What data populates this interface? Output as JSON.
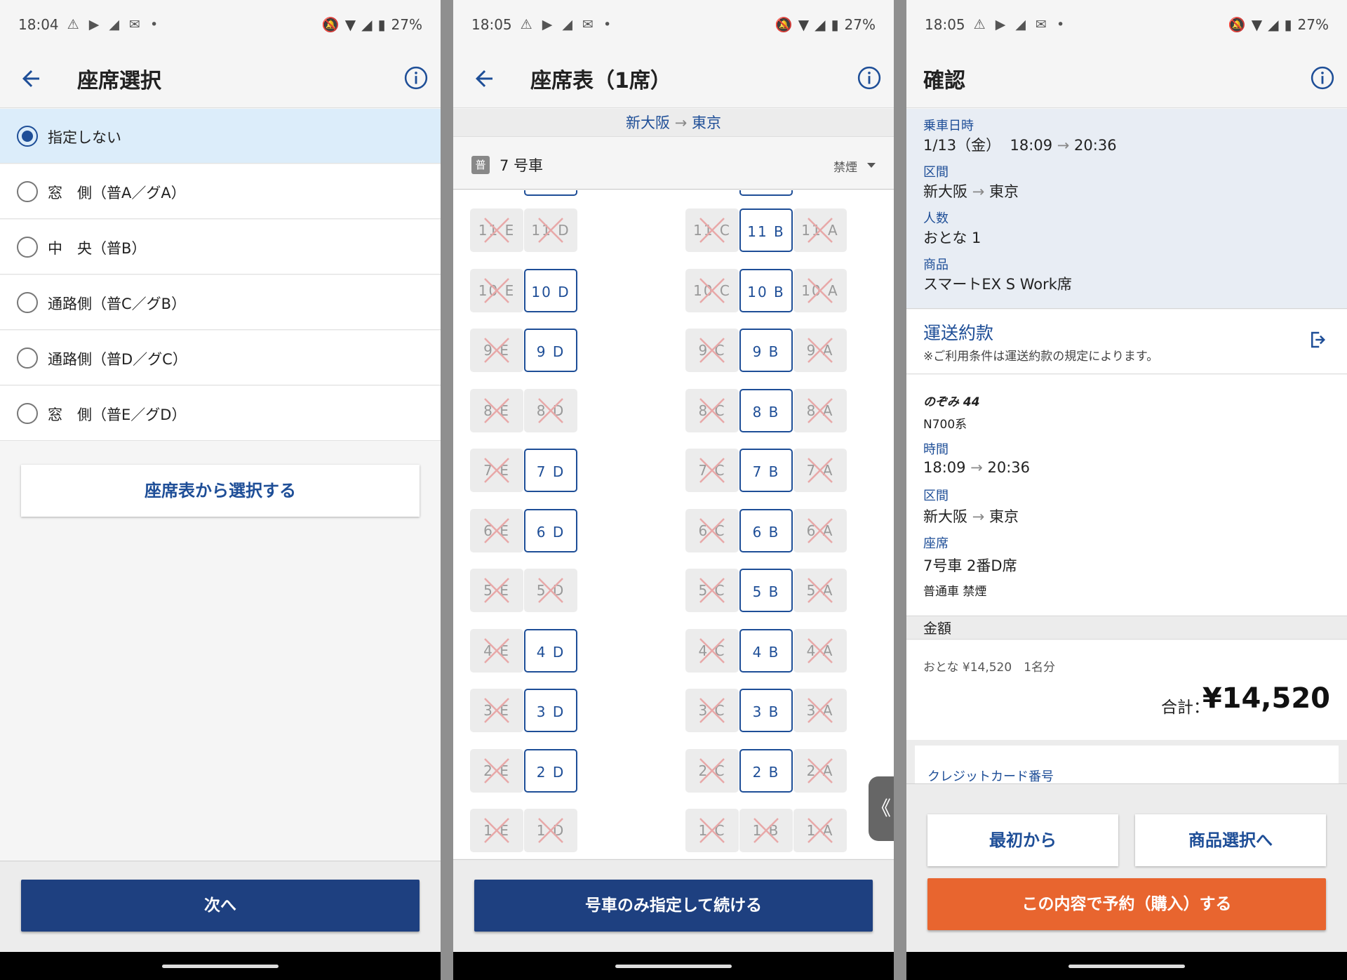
{
  "colors": {
    "brand": "#1e4080",
    "link": "#1e4e97",
    "accent": "#e8652f"
  },
  "s1": {
    "status": {
      "time": "18:04",
      "battery": "27%"
    },
    "title": "座席選択",
    "options": [
      "指定しない",
      "窓　側（普A／グA）",
      "中　央（普B）",
      "通路側（普C／グB）",
      "通路側（普D／グC）",
      "窓　側（普E／グD）"
    ],
    "selected_index": 0,
    "map_button": "座席表から選択する",
    "next_button": "次へ"
  },
  "s2": {
    "status": {
      "time": "18:05",
      "battery": "27%"
    },
    "title": "座席表（1席）",
    "route_from": "新大阪",
    "route_to": "東京",
    "car_badge": "普",
    "car_label": "7 号車",
    "smoking": "禁煙",
    "rows": [
      {
        "row": "11",
        "E": "taken",
        "D": "taken",
        "C": "taken",
        "B": "avail",
        "A": "taken"
      },
      {
        "row": "10",
        "E": "taken",
        "D": "avail",
        "C": "taken",
        "B": "avail",
        "A": "taken"
      },
      {
        "row": "9",
        "E": "taken",
        "D": "avail",
        "C": "taken",
        "B": "avail",
        "A": "taken"
      },
      {
        "row": "8",
        "E": "taken",
        "D": "taken",
        "C": "taken",
        "B": "avail",
        "A": "taken"
      },
      {
        "row": "7",
        "E": "taken",
        "D": "avail",
        "C": "taken",
        "B": "avail",
        "A": "taken"
      },
      {
        "row": "6",
        "E": "taken",
        "D": "avail",
        "C": "taken",
        "B": "avail",
        "A": "taken"
      },
      {
        "row": "5",
        "E": "taken",
        "D": "taken",
        "C": "taken",
        "B": "avail",
        "A": "taken"
      },
      {
        "row": "4",
        "E": "taken",
        "D": "avail",
        "C": "taken",
        "B": "avail",
        "A": "taken"
      },
      {
        "row": "3",
        "E": "taken",
        "D": "avail",
        "C": "taken",
        "B": "avail",
        "A": "taken"
      },
      {
        "row": "2",
        "E": "taken",
        "D": "avail",
        "C": "taken",
        "B": "avail",
        "A": "taken"
      },
      {
        "row": "1",
        "E": "taken",
        "D": "taken",
        "C": "taken",
        "B": "taken",
        "A": "taken"
      }
    ],
    "side_tab": "《",
    "continue_button": "号車のみ指定して続ける"
  },
  "s3": {
    "status": {
      "time": "18:05",
      "battery": "27%"
    },
    "title": "確認",
    "ride_label": "乗車日時",
    "ride_date": "1/13（金）",
    "ride_dep": "18:09",
    "ride_arr": "20:36",
    "section_label": "区間",
    "from": "新大阪",
    "to": "東京",
    "people_label": "人数",
    "people": "おとな 1",
    "product_label": "商品",
    "product": "スマートEX S Work席",
    "terms_title": "運送約款",
    "terms_note": "※ご利用条件は運送約款の規定によります。",
    "train_name": "のぞみ 44",
    "train_type": "N700系",
    "time_label": "時間",
    "dep": "18:09",
    "arr": "20:36",
    "section_label2": "区間",
    "from2": "新大阪",
    "to2": "東京",
    "seat_label": "座席",
    "seat": "7号車 2番D席",
    "seat_class": "普通車 禁煙",
    "price_header": "金額",
    "price_line": "おとな ¥14,520　1名分",
    "total_label": "合計：",
    "total": "¥14,520",
    "cc_label": "クレジットカード番号",
    "restart_button": "最初から",
    "product_button": "商品選択へ",
    "purchase_button": "この内容で予約（購入）する"
  }
}
